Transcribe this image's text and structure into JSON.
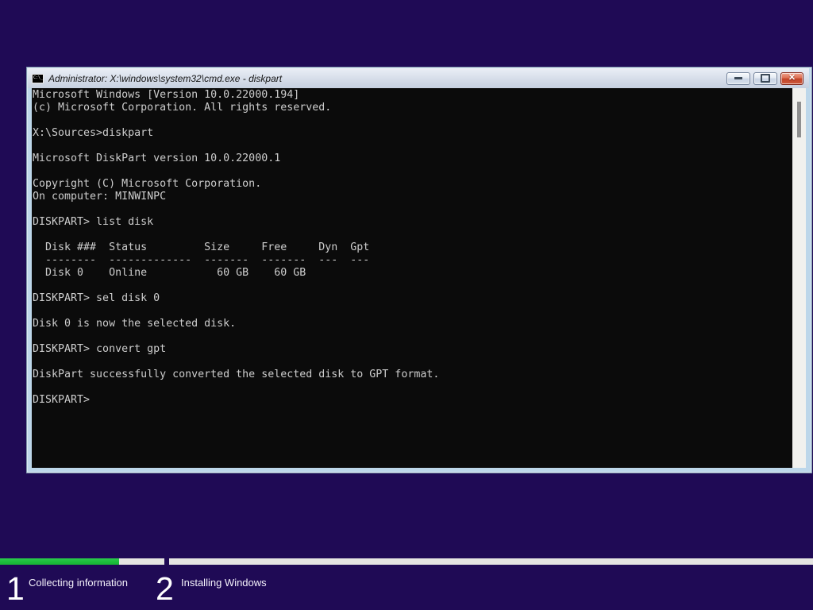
{
  "window": {
    "title": "Administrator: X:\\windows\\system32\\cmd.exe - diskpart",
    "icon_text": "C:\\_",
    "close_glyph": "✕",
    "console_lines": [
      "Microsoft Windows [Version 10.0.22000.194]",
      "(c) Microsoft Corporation. All rights reserved.",
      "",
      "X:\\Sources>diskpart",
      "",
      "Microsoft DiskPart version 10.0.22000.1",
      "",
      "Copyright (C) Microsoft Corporation.",
      "On computer: MINWINPC",
      "",
      "DISKPART> list disk",
      "",
      "  Disk ###  Status         Size     Free     Dyn  Gpt",
      "  --------  -------------  -------  -------  ---  ---",
      "  Disk 0    Online           60 GB    60 GB",
      "",
      "DISKPART> sel disk 0",
      "",
      "Disk 0 is now the selected disk.",
      "",
      "DISKPART> convert gpt",
      "",
      "DiskPart successfully converted the selected disk to GPT format.",
      "",
      "DISKPART>"
    ]
  },
  "disk_table": {
    "headers": [
      "Disk ###",
      "Status",
      "Size",
      "Free",
      "Dyn",
      "Gpt"
    ],
    "rows": [
      [
        "Disk 0",
        "Online",
        "60 GB",
        "60 GB",
        "",
        ""
      ]
    ]
  },
  "progress": {
    "step1_fill_percent": 72.5,
    "bar_color": "#1bbd3a",
    "track_color": "#e5e5e2"
  },
  "steps": [
    {
      "number": "1",
      "label": "Collecting information"
    },
    {
      "number": "2",
      "label": "Installing Windows"
    }
  ],
  "colors": {
    "background": "#1f0a55",
    "console_background": "#0b0b0b",
    "console_text": "#cdcdcd",
    "titlebar": "#d6dde9"
  }
}
